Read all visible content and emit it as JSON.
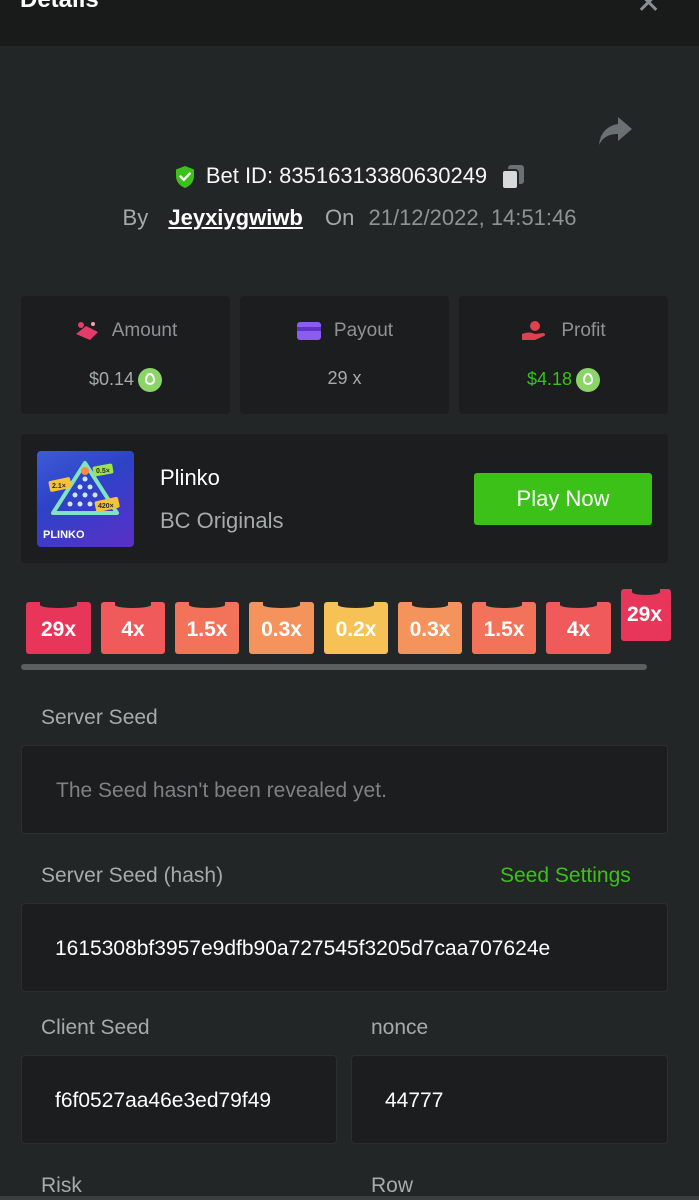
{
  "header": {
    "title": "Details",
    "close_glyph": "✕"
  },
  "bet": {
    "id_label": "Bet ID: 83516313380630249",
    "by_label": "By",
    "username": "Jeyxiygwiwb",
    "on_label": "On",
    "date": "21/12/2022, 14:51:46"
  },
  "stats": {
    "amount_label": "Amount",
    "amount_value": "$0.14",
    "payout_label": "Payout",
    "payout_value": "29 x",
    "profit_label": "Profit",
    "profit_value": "$4.18"
  },
  "game": {
    "name": "Plinko",
    "provider": "BC Originals",
    "play_label": "Play Now",
    "thumb_text": "PLINKO",
    "thumb_badges": [
      "2.1×",
      "0.5×",
      "420×"
    ]
  },
  "multipliers": [
    {
      "label": "29x",
      "color": "#e8365a"
    },
    {
      "label": "4x",
      "color": "#f05a5a"
    },
    {
      "label": "1.5x",
      "color": "#f2735a"
    },
    {
      "label": "0.3x",
      "color": "#f5935c"
    },
    {
      "label": "0.2x",
      "color": "#f7c255"
    },
    {
      "label": "0.3x",
      "color": "#f5935c"
    },
    {
      "label": "1.5x",
      "color": "#f2735a"
    },
    {
      "label": "4x",
      "color": "#f05a5a"
    },
    {
      "label": "29x",
      "color": "#e8365a"
    }
  ],
  "seeds": {
    "server_seed_label": "Server Seed",
    "server_seed_value": "The Seed hasn't been revealed yet.",
    "server_hash_label": "Server Seed (hash)",
    "seed_settings_label": "Seed Settings",
    "server_hash_value": "1615308bf3957e9dfb90a727545f3205d7caa707624e",
    "client_seed_label": "Client Seed",
    "client_seed_value": "f6f0527aa46e3ed79f49",
    "nonce_label": "nonce",
    "nonce_value": "44777",
    "risk_label": "Risk",
    "row_label": "Row"
  },
  "colors": {
    "accent": "#3bc117",
    "panel": "#1b1d1e",
    "background": "#232626"
  }
}
